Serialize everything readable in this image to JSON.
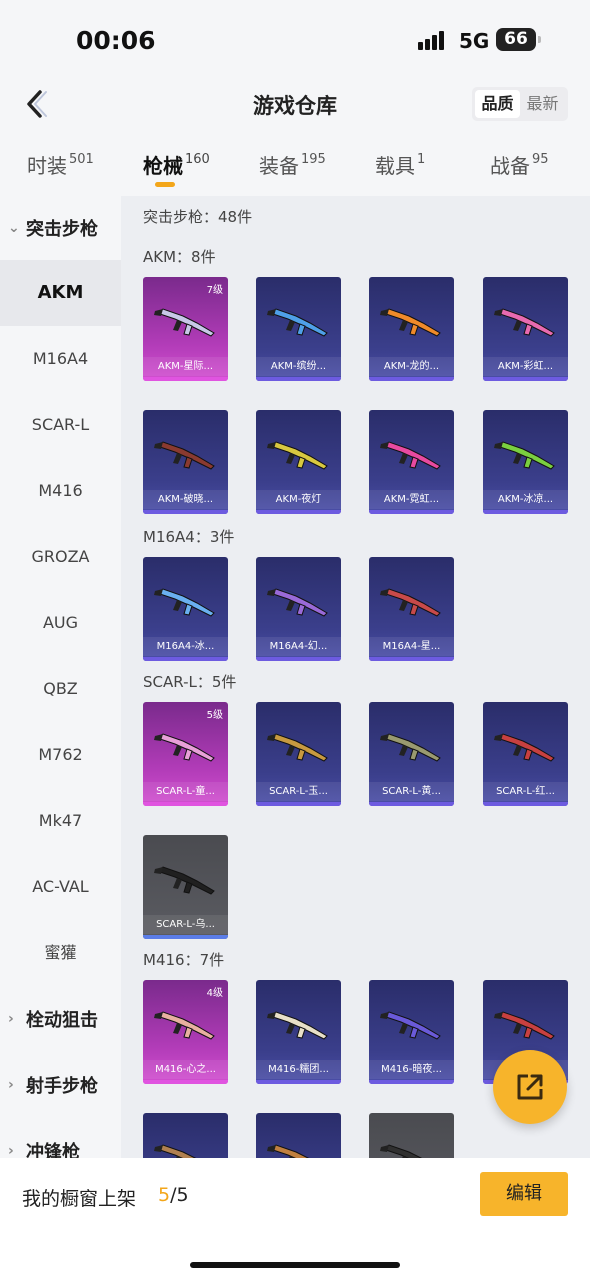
{
  "status": {
    "time": "00:06",
    "network": "5G",
    "battery": "66"
  },
  "header": {
    "title": "游戏仓库",
    "sort": [
      "品质",
      "最新"
    ]
  },
  "tabs": [
    {
      "label": "时装",
      "count": "501"
    },
    {
      "label": "枪械",
      "count": "160"
    },
    {
      "label": "装备",
      "count": "195"
    },
    {
      "label": "载具",
      "count": "1"
    },
    {
      "label": "战备",
      "count": "95"
    }
  ],
  "sidebar": {
    "group_open": "突击步枪",
    "items": [
      "AKM",
      "M16A4",
      "SCAR-L",
      "M416",
      "GROZA",
      "AUG",
      "QBZ",
      "M762",
      "Mk47",
      "AC-VAL",
      "蜜獾"
    ],
    "groups_closed": [
      "栓动狙击",
      "射手步枪",
      "冲锋枪"
    ]
  },
  "content": {
    "summary": "突击步枪：48件",
    "sections": [
      {
        "title": "AKM：8件",
        "cards": [
          {
            "label": "AKM-星际...",
            "level": "7级",
            "style": "pink",
            "color": "#c8c8e8"
          },
          {
            "label": "AKM-缤纷...",
            "level": "",
            "style": "blue",
            "color": "#4fa0e8"
          },
          {
            "label": "AKM-龙的...",
            "level": "",
            "style": "blue",
            "color": "#f08a2a"
          },
          {
            "label": "AKM-彩虹...",
            "level": "",
            "style": "blue",
            "color": "#e86ab0"
          },
          {
            "label": "AKM-破晓...",
            "level": "",
            "style": "blue",
            "color": "#8a3a30"
          },
          {
            "label": "AKM-夜灯",
            "level": "",
            "style": "blue",
            "color": "#d8c840"
          },
          {
            "label": "AKM-霓虹...",
            "level": "",
            "style": "blue",
            "color": "#e84aa0"
          },
          {
            "label": "AKM-冰凉...",
            "level": "",
            "style": "blue",
            "color": "#7ad040"
          }
        ]
      },
      {
        "title": "M16A4：3件",
        "cards": [
          {
            "label": "M16A4-冰...",
            "level": "",
            "style": "blue",
            "color": "#6ab0f0"
          },
          {
            "label": "M16A4-幻...",
            "level": "",
            "style": "blue",
            "color": "#9a6ad8"
          },
          {
            "label": "M16A4-星...",
            "level": "",
            "style": "blue",
            "color": "#c84a4a"
          }
        ]
      },
      {
        "title": "SCAR-L：5件",
        "cards": [
          {
            "label": "SCAR-L-童...",
            "level": "5级",
            "style": "pink",
            "color": "#e8a0d8"
          },
          {
            "label": "SCAR-L-玉...",
            "level": "",
            "style": "blue",
            "color": "#c89a40"
          },
          {
            "label": "SCAR-L-黄...",
            "level": "",
            "style": "blue",
            "color": "#9a9a70"
          },
          {
            "label": "SCAR-L-红...",
            "level": "",
            "style": "blue",
            "color": "#c84040"
          },
          {
            "label": "SCAR-L-乌...",
            "level": "",
            "style": "grey",
            "color": "#202020"
          }
        ]
      },
      {
        "title": "M416：7件",
        "cards": [
          {
            "label": "M416-心之...",
            "level": "4级",
            "style": "pink",
            "color": "#e8b0a0"
          },
          {
            "label": "M416-糯团...",
            "level": "",
            "style": "blue",
            "color": "#e8e0c8"
          },
          {
            "label": "M416-暗夜...",
            "level": "",
            "style": "blue",
            "color": "#6a5ad8"
          },
          {
            "label": "M",
            "level": "",
            "style": "blue",
            "color": "#c84040"
          },
          {
            "label": "",
            "level": "",
            "style": "blue",
            "color": "#b08050"
          },
          {
            "label": "",
            "level": "",
            "style": "blue",
            "color": "#c08040"
          },
          {
            "label": "",
            "level": "",
            "style": "grey",
            "color": "#303030"
          }
        ]
      }
    ]
  },
  "footer": {
    "label": "我的橱窗上架",
    "current": "5",
    "total": "/5",
    "edit": "编辑"
  }
}
